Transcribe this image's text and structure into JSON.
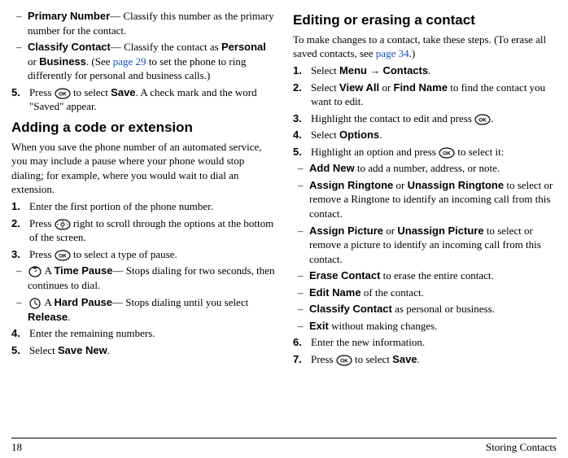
{
  "col1": {
    "pre_sub": [
      {
        "label": "Primary Number",
        "after": "— Classify this number as the primary number for the contact."
      },
      {
        "label": "Classify Contact",
        "after_part1": "— Classify the contact as ",
        "label2": "Personal",
        "mid": " or ",
        "label3": "Business",
        "after_part2": ". (See ",
        "link": "page 29",
        "after_part3": " to set the phone to ring differently for personal and business calls.)"
      }
    ],
    "step5": {
      "num": "5.",
      "pre": "Press ",
      "mid": " to select ",
      "label": "Save",
      "post": ". A check mark and the word \"Saved\" appear."
    },
    "heading1": "Adding a code or extension",
    "para1": "When you save the phone number of an automated service, you may include a pause where your phone would stop dialing; for example, where you would wait to dial an extension.",
    "steps_a": [
      {
        "num": "1.",
        "text": "Enter the first portion of the phone number."
      },
      {
        "num": "2.",
        "pre": "Press ",
        "post": " right to scroll through the options at the bottom of the screen."
      },
      {
        "num": "3.",
        "pre": "Press ",
        "post": " to select a type of pause."
      }
    ],
    "pause_sub": [
      {
        "pre": " A ",
        "label": "Time Pause",
        "post": "— Stops dialing for two seconds, then continues to dial."
      },
      {
        "pre": " A ",
        "label": "Hard Pause",
        "post": "— Stops dialing until you select ",
        "label2": "Release",
        "post2": "."
      }
    ],
    "steps_b": [
      {
        "num": "4.",
        "text": "Enter the remaining numbers."
      },
      {
        "num": "5.",
        "pre": "Select ",
        "label": "Save New",
        "post": "."
      }
    ]
  },
  "col2": {
    "heading": "Editing or erasing a contact",
    "para_pre": "To make changes to a contact, take these steps. (To erase all saved contacts, see ",
    "para_link": "page 34",
    "para_post": ".)",
    "steps": [
      {
        "num": "1.",
        "pre": "Select ",
        "label": "Menu",
        "arrow": " → ",
        "label2": "Contacts",
        "post": "."
      },
      {
        "num": "2.",
        "pre": "Select ",
        "label": "View All",
        "mid": " or ",
        "label2": "Find Name",
        "post": " to find the contact you want to edit."
      },
      {
        "num": "3.",
        "pre": "Highlight the contact to edit and press ",
        "post": "."
      },
      {
        "num": "4.",
        "pre": "Select ",
        "label": "Options",
        "post": "."
      },
      {
        "num": "5.",
        "pre": "Highlight an option and press ",
        "post": " to select it:"
      }
    ],
    "sub": [
      {
        "label": "Add New",
        "post": " to add a number, address, or note."
      },
      {
        "label": "Assign Ringtone",
        "mid": " or ",
        "label2": "Unassign Ringtone",
        "post": " to select or remove a Ringtone to identify an incoming call from this contact."
      },
      {
        "label": "Assign Picture",
        "mid": " or ",
        "label2": "Unassign Picture",
        "post": " to select or remove a picture to identify an incoming call from this contact."
      },
      {
        "label": "Erase Contact",
        "post": " to erase the entire contact."
      },
      {
        "label": "Edit Name",
        "post": " of the contact."
      },
      {
        "label": "Classify Contact",
        "post": " as personal or business."
      },
      {
        "label": "Exit",
        "post": " without making changes."
      }
    ],
    "steps2": [
      {
        "num": "6.",
        "text": "Enter the new information."
      },
      {
        "num": "7.",
        "pre": "Press ",
        "mid": " to select ",
        "label": "Save",
        "post": "."
      }
    ]
  },
  "footer": {
    "page": "18",
    "section": "Storing Contacts"
  }
}
